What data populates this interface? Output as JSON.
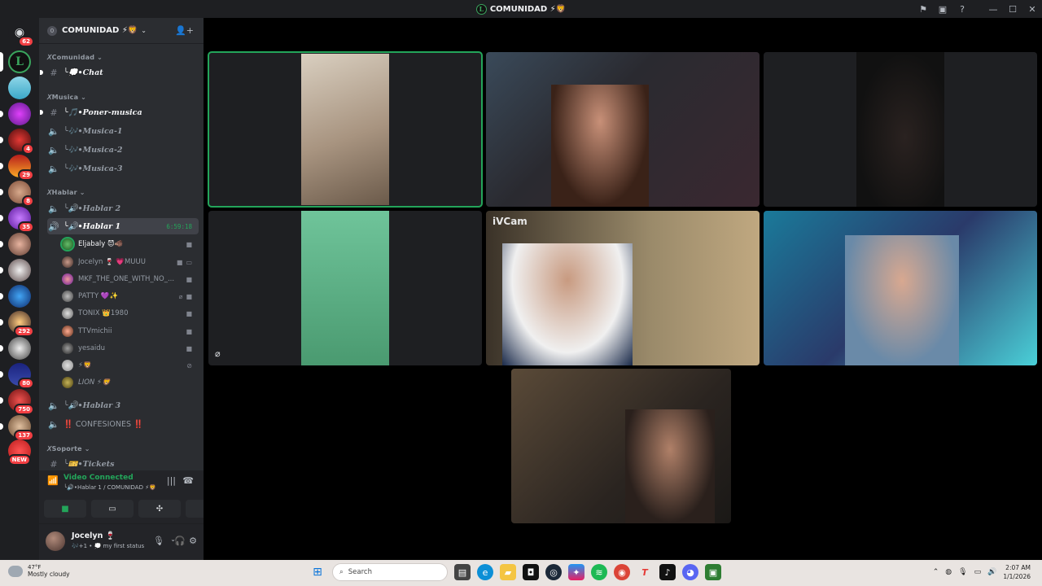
{
  "window": {
    "title": "COMUNIDAD ⚡🦁"
  },
  "rail": {
    "home_badge": "62",
    "badges": [
      "4",
      "29",
      "8",
      "35",
      "292",
      "80",
      "750",
      "137",
      "NEW"
    ]
  },
  "guild": {
    "name": "COMUNIDAD ⚡🦁",
    "boost_level": "0"
  },
  "categories": {
    "comunidad": "𝘟Comunidad ⌄",
    "musica": "𝘟Musica ⌄",
    "hablar": "𝘟Hablar ⌄",
    "soporte": "𝘟Soporte ⌄"
  },
  "channels": {
    "chat": "╰💭•Chat",
    "poner_musica": "╰🎵•Poner-musica",
    "musica1": "╰🎶•Musica-1",
    "musica2": "╰🎶•Musica-2",
    "musica3": "╰🎶•Musica-3",
    "hablar2": "╰🔊•Hablar 2",
    "hablar1": "╰🔊•Hablar 1",
    "hablar1_timer": "6:59:18",
    "hablar3": "╰🔊•Hablar 3",
    "confesiones": "‼️ CONFESIONES ‼️",
    "tickets": "╰🎫•Tickets"
  },
  "voice_users": [
    {
      "name": "Eljabaly 😈🐗"
    },
    {
      "name": "Jocelyn 🍷 💗MUUU"
    },
    {
      "name": "MKF_THE_ONE_WITH_NO_..."
    },
    {
      "name": "PATTY 💜✨"
    },
    {
      "name": "TONIX 👑1980"
    },
    {
      "name": "TTVmichii"
    },
    {
      "name": "yesaidu"
    },
    {
      "name": "⚡🦁"
    },
    {
      "name": "LION ⚡🦁"
    }
  ],
  "voice_panel": {
    "status": "Video Connected",
    "location": "╰🔊•Hablar 1 / COMUNIDAD ⚡🦁"
  },
  "user_panel": {
    "name": "Jocelyn 🍷",
    "status": "🎶+1 • 💭 my first status"
  },
  "tiles": {
    "ivcam_label": "iVCam"
  },
  "taskbar": {
    "temp": "47°F",
    "weather": "Mostly cloudy",
    "search_placeholder": "Search",
    "time": "2:07 AM",
    "date": "1/1/2026"
  }
}
